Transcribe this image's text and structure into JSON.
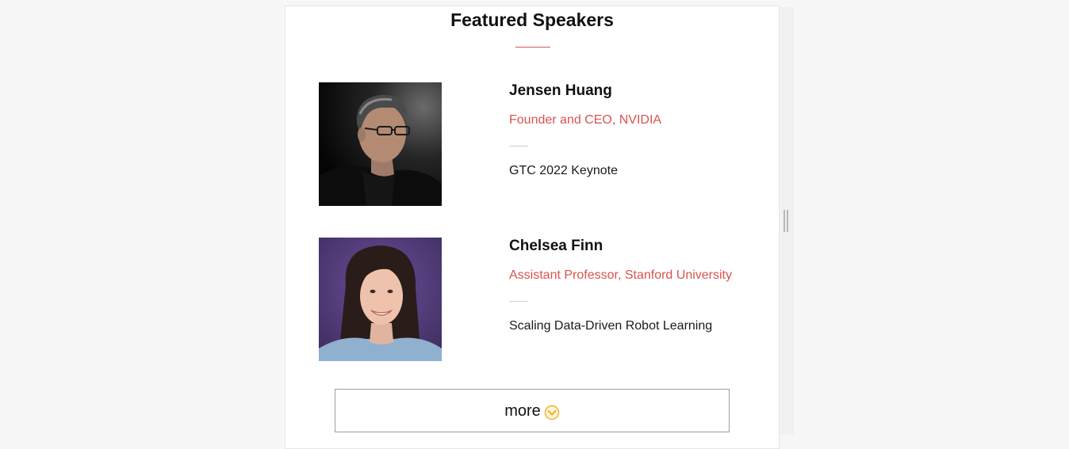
{
  "section": {
    "title": "Featured Speakers",
    "accent": "#d9534f"
  },
  "speakers": [
    {
      "name": "Jensen Huang",
      "role": "Founder and CEO, NVIDIA",
      "talk": "GTC 2022 Keynote",
      "photo_icon": "speaker-photo-icon"
    },
    {
      "name": "Chelsea Finn",
      "role": "Assistant Professor, Stanford University",
      "talk": "Scaling Data-Driven Robot Learning",
      "photo_icon": "speaker-photo-icon"
    }
  ],
  "more_button": {
    "label": "more",
    "icon": "chevron-down-icon",
    "icon_color": "#f0b429"
  }
}
